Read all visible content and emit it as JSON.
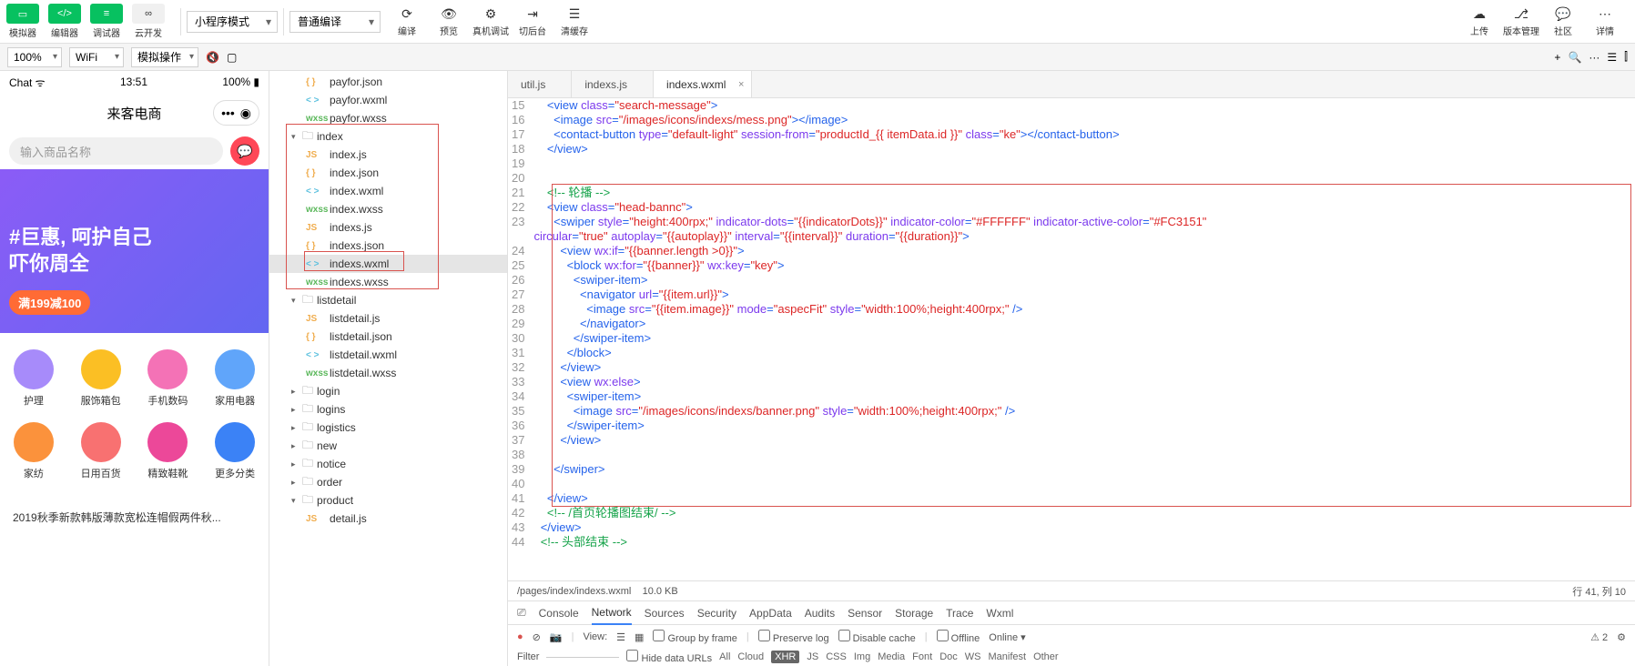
{
  "toolbar": {
    "buttons1": [
      {
        "icon": "▭",
        "label": "模拟器",
        "style": "green"
      },
      {
        "icon": "</>",
        "label": "编辑器",
        "style": "green"
      },
      {
        "icon": "≡",
        "label": "调试器",
        "style": "green"
      },
      {
        "icon": "∞",
        "label": "云开发",
        "style": "gray"
      }
    ],
    "dropdown_mode": "小程序模式",
    "dropdown_compile": "普通编译",
    "buttons2": [
      {
        "icon": "⟳",
        "label": "编译"
      },
      {
        "icon": "👁",
        "label": "预览"
      },
      {
        "icon": "⚙",
        "label": "真机调试"
      },
      {
        "icon": "⇥",
        "label": "切后台"
      },
      {
        "icon": "☰",
        "label": "清缓存"
      }
    ],
    "buttons3": [
      {
        "icon": "☁",
        "label": "上传"
      },
      {
        "icon": "⎇",
        "label": "版本管理"
      },
      {
        "icon": "💬",
        "label": "社区"
      },
      {
        "icon": "⋯",
        "label": "详情"
      }
    ]
  },
  "secondary": {
    "zoom": "100%",
    "network": "WiFi",
    "operation": "模拟操作"
  },
  "simulator": {
    "carrier": "Chat ᯤ",
    "time": "13:51",
    "battery": "100%",
    "title": "来客电商",
    "search_placeholder": "输入商品名称",
    "banner_line1": "#巨惠, 呵护自己",
    "banner_line2": "吓你周全",
    "banner_tag": "满199减100",
    "categories": [
      {
        "name": "护理",
        "color": "#a78bfa"
      },
      {
        "name": "服饰箱包",
        "color": "#fbbf24"
      },
      {
        "name": "手机数码",
        "color": "#f472b6"
      },
      {
        "name": "家用电器",
        "color": "#60a5fa"
      },
      {
        "name": "家纺",
        "color": "#fb923c"
      },
      {
        "name": "日用百货",
        "color": "#f87171"
      },
      {
        "name": "精致鞋靴",
        "color": "#ec4899"
      },
      {
        "name": "更多分类",
        "color": "#3b82f6"
      }
    ],
    "product1": "2019秋季新款韩版薄款宽松连帽假两件秋..."
  },
  "file_tree": [
    {
      "indent": 2,
      "type": "file",
      "ext": "json",
      "name": "payfor.json"
    },
    {
      "indent": 2,
      "type": "file",
      "ext": "wxml",
      "name": "payfor.wxml"
    },
    {
      "indent": 2,
      "type": "file",
      "ext": "wxss",
      "name": "payfor.wxss"
    },
    {
      "indent": 1,
      "type": "folder-open",
      "name": "index"
    },
    {
      "indent": 2,
      "type": "file",
      "ext": "js",
      "name": "index.js"
    },
    {
      "indent": 2,
      "type": "file",
      "ext": "json",
      "name": "index.json"
    },
    {
      "indent": 2,
      "type": "file",
      "ext": "wxml",
      "name": "index.wxml"
    },
    {
      "indent": 2,
      "type": "file",
      "ext": "wxss",
      "name": "index.wxss"
    },
    {
      "indent": 2,
      "type": "file",
      "ext": "js",
      "name": "indexs.js"
    },
    {
      "indent": 2,
      "type": "file",
      "ext": "json",
      "name": "indexs.json"
    },
    {
      "indent": 2,
      "type": "file",
      "ext": "wxml",
      "name": "indexs.wxml",
      "selected": true
    },
    {
      "indent": 2,
      "type": "file",
      "ext": "wxss",
      "name": "indexs.wxss"
    },
    {
      "indent": 1,
      "type": "folder-open",
      "name": "listdetail"
    },
    {
      "indent": 2,
      "type": "file",
      "ext": "js",
      "name": "listdetail.js"
    },
    {
      "indent": 2,
      "type": "file",
      "ext": "json",
      "name": "listdetail.json"
    },
    {
      "indent": 2,
      "type": "file",
      "ext": "wxml",
      "name": "listdetail.wxml"
    },
    {
      "indent": 2,
      "type": "file",
      "ext": "wxss",
      "name": "listdetail.wxss"
    },
    {
      "indent": 1,
      "type": "folder",
      "name": "login"
    },
    {
      "indent": 1,
      "type": "folder",
      "name": "logins"
    },
    {
      "indent": 1,
      "type": "folder",
      "name": "logistics"
    },
    {
      "indent": 1,
      "type": "folder",
      "name": "new"
    },
    {
      "indent": 1,
      "type": "folder",
      "name": "notice"
    },
    {
      "indent": 1,
      "type": "folder",
      "name": "order"
    },
    {
      "indent": 1,
      "type": "folder-open",
      "name": "product"
    },
    {
      "indent": 2,
      "type": "file",
      "ext": "js",
      "name": "detail.js"
    }
  ],
  "editor": {
    "tabs": [
      {
        "name": "util.js",
        "active": false
      },
      {
        "name": "indexs.js",
        "active": false
      },
      {
        "name": "indexs.wxml",
        "active": true
      }
    ],
    "first_line": 15,
    "code_tokens": [
      [
        {
          "t": "    <",
          "c": "punct"
        },
        {
          "t": "view ",
          "c": "tag"
        },
        {
          "t": "class",
          "c": "attr"
        },
        {
          "t": "=",
          "c": "punct"
        },
        {
          "t": "\"search-message\"",
          "c": "str"
        },
        {
          "t": ">",
          "c": "punct"
        }
      ],
      [
        {
          "t": "      <",
          "c": "punct"
        },
        {
          "t": "image ",
          "c": "tag"
        },
        {
          "t": "src",
          "c": "attr"
        },
        {
          "t": "=",
          "c": "punct"
        },
        {
          "t": "\"/images/icons/indexs/mess.png\"",
          "c": "str"
        },
        {
          "t": "></",
          "c": "punct"
        },
        {
          "t": "image",
          "c": "tag"
        },
        {
          "t": ">",
          "c": "punct"
        }
      ],
      [
        {
          "t": "      <",
          "c": "punct"
        },
        {
          "t": "contact-button ",
          "c": "tag"
        },
        {
          "t": "type",
          "c": "attr"
        },
        {
          "t": "=",
          "c": "punct"
        },
        {
          "t": "\"default-light\"",
          "c": "str"
        },
        {
          "t": " session-from",
          "c": "attr"
        },
        {
          "t": "=",
          "c": "punct"
        },
        {
          "t": "\"productId_{{ itemData.id }}\"",
          "c": "str"
        },
        {
          "t": " class",
          "c": "attr"
        },
        {
          "t": "=",
          "c": "punct"
        },
        {
          "t": "\"ke\"",
          "c": "str"
        },
        {
          "t": "></",
          "c": "punct"
        },
        {
          "t": "contact-button",
          "c": "tag"
        },
        {
          "t": ">",
          "c": "punct"
        }
      ],
      [
        {
          "t": "    </",
          "c": "punct"
        },
        {
          "t": "view",
          "c": "tag"
        },
        {
          "t": ">",
          "c": "punct"
        }
      ],
      [],
      [],
      [
        {
          "t": "    <!-- 轮播 -->",
          "c": "comment"
        }
      ],
      [
        {
          "t": "    <",
          "c": "punct"
        },
        {
          "t": "view ",
          "c": "tag"
        },
        {
          "t": "class",
          "c": "attr"
        },
        {
          "t": "=",
          "c": "punct"
        },
        {
          "t": "\"head-bannc\"",
          "c": "str"
        },
        {
          "t": ">",
          "c": "punct"
        }
      ],
      [
        {
          "t": "      <",
          "c": "punct"
        },
        {
          "t": "swiper ",
          "c": "tag"
        },
        {
          "t": "style",
          "c": "attr"
        },
        {
          "t": "=",
          "c": "punct"
        },
        {
          "t": "\"height:400rpx;\"",
          "c": "str"
        },
        {
          "t": " indicator-dots",
          "c": "attr"
        },
        {
          "t": "=",
          "c": "punct"
        },
        {
          "t": "\"{{indicatorDots}}\"",
          "c": "str"
        },
        {
          "t": " indicator-color",
          "c": "attr"
        },
        {
          "t": "=",
          "c": "punct"
        },
        {
          "t": "\"#FFFFFF\"",
          "c": "str"
        },
        {
          "t": " indicator-active-color",
          "c": "attr"
        },
        {
          "t": "=",
          "c": "punct"
        },
        {
          "t": "\"#FC3151\"",
          "c": "str"
        }
      ],
      [
        {
          "t": "circular",
          "c": "attr"
        },
        {
          "t": "=",
          "c": "punct"
        },
        {
          "t": "\"true\"",
          "c": "str"
        },
        {
          "t": " autoplay",
          "c": "attr"
        },
        {
          "t": "=",
          "c": "punct"
        },
        {
          "t": "\"{{autoplay}}\"",
          "c": "str"
        },
        {
          "t": " interval",
          "c": "attr"
        },
        {
          "t": "=",
          "c": "punct"
        },
        {
          "t": "\"{{interval}}\"",
          "c": "str"
        },
        {
          "t": " duration",
          "c": "attr"
        },
        {
          "t": "=",
          "c": "punct"
        },
        {
          "t": "\"{{duration}}\"",
          "c": "str"
        },
        {
          "t": ">",
          "c": "punct"
        }
      ],
      [
        {
          "t": "        <",
          "c": "punct"
        },
        {
          "t": "view ",
          "c": "tag"
        },
        {
          "t": "wx:if",
          "c": "attr"
        },
        {
          "t": "=",
          "c": "punct"
        },
        {
          "t": "\"{{banner.length >0}}\"",
          "c": "str"
        },
        {
          "t": ">",
          "c": "punct"
        }
      ],
      [
        {
          "t": "          <",
          "c": "punct"
        },
        {
          "t": "block ",
          "c": "tag"
        },
        {
          "t": "wx:for",
          "c": "attr"
        },
        {
          "t": "=",
          "c": "punct"
        },
        {
          "t": "\"{{banner}}\"",
          "c": "str"
        },
        {
          "t": " wx:key",
          "c": "attr"
        },
        {
          "t": "=",
          "c": "punct"
        },
        {
          "t": "\"key\"",
          "c": "str"
        },
        {
          "t": ">",
          "c": "punct"
        }
      ],
      [
        {
          "t": "            <",
          "c": "punct"
        },
        {
          "t": "swiper-item",
          "c": "tag"
        },
        {
          "t": ">",
          "c": "punct"
        }
      ],
      [
        {
          "t": "              <",
          "c": "punct"
        },
        {
          "t": "navigator ",
          "c": "tag"
        },
        {
          "t": "url",
          "c": "attr"
        },
        {
          "t": "=",
          "c": "punct"
        },
        {
          "t": "\"{{item.url}}\"",
          "c": "str"
        },
        {
          "t": ">",
          "c": "punct"
        }
      ],
      [
        {
          "t": "                <",
          "c": "punct"
        },
        {
          "t": "image ",
          "c": "tag"
        },
        {
          "t": "src",
          "c": "attr"
        },
        {
          "t": "=",
          "c": "punct"
        },
        {
          "t": "\"{{item.image}}\"",
          "c": "str"
        },
        {
          "t": " mode",
          "c": "attr"
        },
        {
          "t": "=",
          "c": "punct"
        },
        {
          "t": "\"aspecFit\"",
          "c": "str"
        },
        {
          "t": " style",
          "c": "attr"
        },
        {
          "t": "=",
          "c": "punct"
        },
        {
          "t": "\"width:100%;height:400rpx;\"",
          "c": "str"
        },
        {
          "t": " />",
          "c": "punct"
        }
      ],
      [
        {
          "t": "              </",
          "c": "punct"
        },
        {
          "t": "navigator",
          "c": "tag"
        },
        {
          "t": ">",
          "c": "punct"
        }
      ],
      [
        {
          "t": "            </",
          "c": "punct"
        },
        {
          "t": "swiper-item",
          "c": "tag"
        },
        {
          "t": ">",
          "c": "punct"
        }
      ],
      [
        {
          "t": "          </",
          "c": "punct"
        },
        {
          "t": "block",
          "c": "tag"
        },
        {
          "t": ">",
          "c": "punct"
        }
      ],
      [
        {
          "t": "        </",
          "c": "punct"
        },
        {
          "t": "view",
          "c": "tag"
        },
        {
          "t": ">",
          "c": "punct"
        }
      ],
      [
        {
          "t": "        <",
          "c": "punct"
        },
        {
          "t": "view ",
          "c": "tag"
        },
        {
          "t": "wx:else",
          "c": "attr"
        },
        {
          "t": ">",
          "c": "punct"
        }
      ],
      [
        {
          "t": "          <",
          "c": "punct"
        },
        {
          "t": "swiper-item",
          "c": "tag"
        },
        {
          "t": ">",
          "c": "punct"
        }
      ],
      [
        {
          "t": "            <",
          "c": "punct"
        },
        {
          "t": "image ",
          "c": "tag"
        },
        {
          "t": "src",
          "c": "attr"
        },
        {
          "t": "=",
          "c": "punct"
        },
        {
          "t": "\"/images/icons/indexs/banner.png\"",
          "c": "str"
        },
        {
          "t": " style",
          "c": "attr"
        },
        {
          "t": "=",
          "c": "punct"
        },
        {
          "t": "\"width:100%;height:400rpx;\"",
          "c": "str"
        },
        {
          "t": " />",
          "c": "punct"
        }
      ],
      [
        {
          "t": "          </",
          "c": "punct"
        },
        {
          "t": "swiper-item",
          "c": "tag"
        },
        {
          "t": ">",
          "c": "punct"
        }
      ],
      [
        {
          "t": "        </",
          "c": "punct"
        },
        {
          "t": "view",
          "c": "tag"
        },
        {
          "t": ">",
          "c": "punct"
        }
      ],
      [],
      [
        {
          "t": "      </",
          "c": "punct"
        },
        {
          "t": "swiper",
          "c": "tag"
        },
        {
          "t": ">",
          "c": "punct"
        }
      ],
      [],
      [
        {
          "t": "    </",
          "c": "punct"
        },
        {
          "t": "view",
          "c": "tag"
        },
        {
          "t": ">",
          "c": "punct"
        }
      ],
      [
        {
          "t": "    <!-- /首页轮播图结束/ -->",
          "c": "comment"
        }
      ],
      [
        {
          "t": "  </",
          "c": "punct"
        },
        {
          "t": "view",
          "c": "tag"
        },
        {
          "t": ">",
          "c": "punct"
        }
      ],
      [
        {
          "t": "  <!-- 头部结束 -->",
          "c": "comment"
        }
      ]
    ],
    "status_path": "/pages/index/indexs.wxml",
    "status_size": "10.0 KB",
    "status_pos": "行 41, 列 10"
  },
  "console": {
    "tabs": [
      "Console",
      "Network",
      "Sources",
      "Security",
      "AppData",
      "Audits",
      "Sensor",
      "Storage",
      "Trace",
      "Wxml"
    ],
    "active_tab": "Network",
    "warn_count": "⚠ 2",
    "view_label": "View:",
    "cb1": "Group by frame",
    "cb2": "Preserve log",
    "cb3": "Disable cache",
    "offline": "Offline",
    "online": "Online",
    "filter_label": "Filter",
    "filter_hide": "Hide data URLs",
    "filters": [
      "All",
      "Cloud",
      "XHR",
      "JS",
      "CSS",
      "Img",
      "Media",
      "Font",
      "Doc",
      "WS",
      "Manifest",
      "Other"
    ]
  }
}
